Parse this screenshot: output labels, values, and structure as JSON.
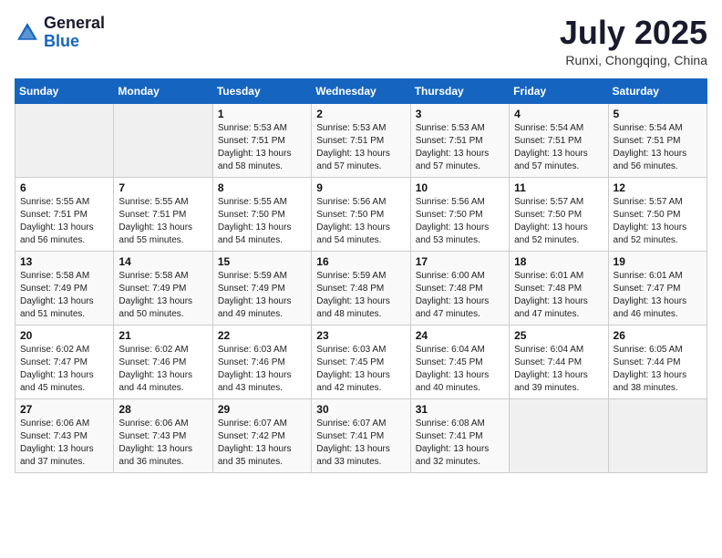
{
  "header": {
    "logo_general": "General",
    "logo_blue": "Blue",
    "month_title": "July 2025",
    "location": "Runxi, Chongqing, China"
  },
  "weekdays": [
    "Sunday",
    "Monday",
    "Tuesday",
    "Wednesday",
    "Thursday",
    "Friday",
    "Saturday"
  ],
  "weeks": [
    [
      {
        "day": "",
        "info": ""
      },
      {
        "day": "",
        "info": ""
      },
      {
        "day": "1",
        "info": "Sunrise: 5:53 AM\nSunset: 7:51 PM\nDaylight: 13 hours and 58 minutes."
      },
      {
        "day": "2",
        "info": "Sunrise: 5:53 AM\nSunset: 7:51 PM\nDaylight: 13 hours and 57 minutes."
      },
      {
        "day": "3",
        "info": "Sunrise: 5:53 AM\nSunset: 7:51 PM\nDaylight: 13 hours and 57 minutes."
      },
      {
        "day": "4",
        "info": "Sunrise: 5:54 AM\nSunset: 7:51 PM\nDaylight: 13 hours and 57 minutes."
      },
      {
        "day": "5",
        "info": "Sunrise: 5:54 AM\nSunset: 7:51 PM\nDaylight: 13 hours and 56 minutes."
      }
    ],
    [
      {
        "day": "6",
        "info": "Sunrise: 5:55 AM\nSunset: 7:51 PM\nDaylight: 13 hours and 56 minutes."
      },
      {
        "day": "7",
        "info": "Sunrise: 5:55 AM\nSunset: 7:51 PM\nDaylight: 13 hours and 55 minutes."
      },
      {
        "day": "8",
        "info": "Sunrise: 5:55 AM\nSunset: 7:50 PM\nDaylight: 13 hours and 54 minutes."
      },
      {
        "day": "9",
        "info": "Sunrise: 5:56 AM\nSunset: 7:50 PM\nDaylight: 13 hours and 54 minutes."
      },
      {
        "day": "10",
        "info": "Sunrise: 5:56 AM\nSunset: 7:50 PM\nDaylight: 13 hours and 53 minutes."
      },
      {
        "day": "11",
        "info": "Sunrise: 5:57 AM\nSunset: 7:50 PM\nDaylight: 13 hours and 52 minutes."
      },
      {
        "day": "12",
        "info": "Sunrise: 5:57 AM\nSunset: 7:50 PM\nDaylight: 13 hours and 52 minutes."
      }
    ],
    [
      {
        "day": "13",
        "info": "Sunrise: 5:58 AM\nSunset: 7:49 PM\nDaylight: 13 hours and 51 minutes."
      },
      {
        "day": "14",
        "info": "Sunrise: 5:58 AM\nSunset: 7:49 PM\nDaylight: 13 hours and 50 minutes."
      },
      {
        "day": "15",
        "info": "Sunrise: 5:59 AM\nSunset: 7:49 PM\nDaylight: 13 hours and 49 minutes."
      },
      {
        "day": "16",
        "info": "Sunrise: 5:59 AM\nSunset: 7:48 PM\nDaylight: 13 hours and 48 minutes."
      },
      {
        "day": "17",
        "info": "Sunrise: 6:00 AM\nSunset: 7:48 PM\nDaylight: 13 hours and 47 minutes."
      },
      {
        "day": "18",
        "info": "Sunrise: 6:01 AM\nSunset: 7:48 PM\nDaylight: 13 hours and 47 minutes."
      },
      {
        "day": "19",
        "info": "Sunrise: 6:01 AM\nSunset: 7:47 PM\nDaylight: 13 hours and 46 minutes."
      }
    ],
    [
      {
        "day": "20",
        "info": "Sunrise: 6:02 AM\nSunset: 7:47 PM\nDaylight: 13 hours and 45 minutes."
      },
      {
        "day": "21",
        "info": "Sunrise: 6:02 AM\nSunset: 7:46 PM\nDaylight: 13 hours and 44 minutes."
      },
      {
        "day": "22",
        "info": "Sunrise: 6:03 AM\nSunset: 7:46 PM\nDaylight: 13 hours and 43 minutes."
      },
      {
        "day": "23",
        "info": "Sunrise: 6:03 AM\nSunset: 7:45 PM\nDaylight: 13 hours and 42 minutes."
      },
      {
        "day": "24",
        "info": "Sunrise: 6:04 AM\nSunset: 7:45 PM\nDaylight: 13 hours and 40 minutes."
      },
      {
        "day": "25",
        "info": "Sunrise: 6:04 AM\nSunset: 7:44 PM\nDaylight: 13 hours and 39 minutes."
      },
      {
        "day": "26",
        "info": "Sunrise: 6:05 AM\nSunset: 7:44 PM\nDaylight: 13 hours and 38 minutes."
      }
    ],
    [
      {
        "day": "27",
        "info": "Sunrise: 6:06 AM\nSunset: 7:43 PM\nDaylight: 13 hours and 37 minutes."
      },
      {
        "day": "28",
        "info": "Sunrise: 6:06 AM\nSunset: 7:43 PM\nDaylight: 13 hours and 36 minutes."
      },
      {
        "day": "29",
        "info": "Sunrise: 6:07 AM\nSunset: 7:42 PM\nDaylight: 13 hours and 35 minutes."
      },
      {
        "day": "30",
        "info": "Sunrise: 6:07 AM\nSunset: 7:41 PM\nDaylight: 13 hours and 33 minutes."
      },
      {
        "day": "31",
        "info": "Sunrise: 6:08 AM\nSunset: 7:41 PM\nDaylight: 13 hours and 32 minutes."
      },
      {
        "day": "",
        "info": ""
      },
      {
        "day": "",
        "info": ""
      }
    ]
  ]
}
